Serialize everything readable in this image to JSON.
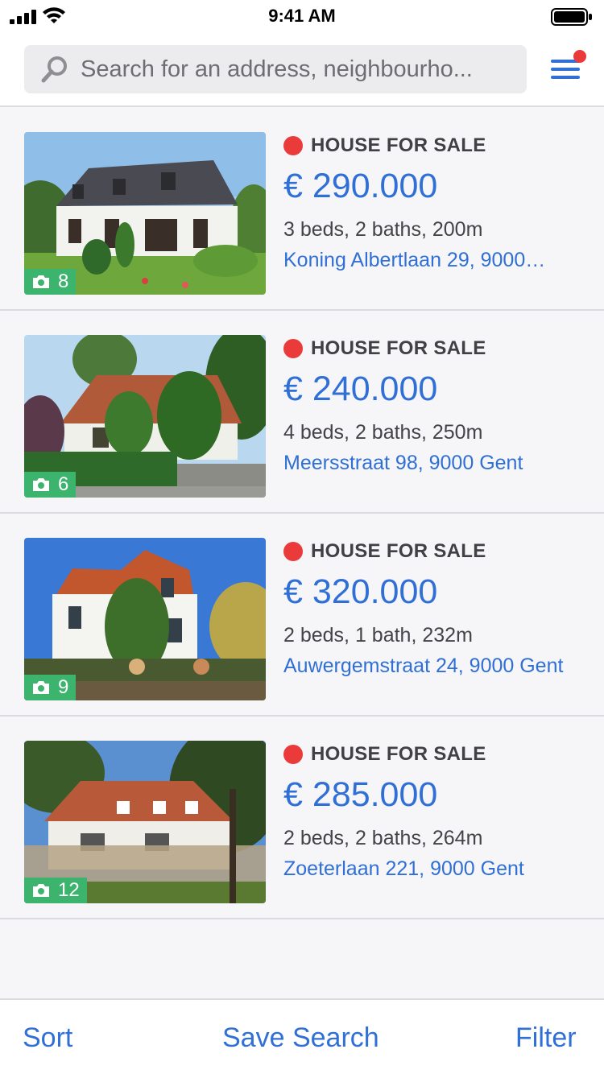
{
  "status_bar": {
    "time": "9:41 AM"
  },
  "search": {
    "placeholder": "Search for an address, neighbourho..."
  },
  "listings": [
    {
      "type": "HOUSE FOR SALE",
      "price": "€ 290.000",
      "specs": "3 beds, 2 baths, 200m",
      "address": "Koning Albertlaan 29, 9000…",
      "photo_count": "8"
    },
    {
      "type": "HOUSE FOR SALE",
      "price": "€ 240.000",
      "specs": "4 beds, 2 baths, 250m",
      "address": "Meersstraat 98, 9000 Gent",
      "photo_count": "6"
    },
    {
      "type": "HOUSE FOR SALE",
      "price": "€ 320.000",
      "specs": "2 beds, 1 bath, 232m",
      "address": "Auwergemstraat 24, 9000 Gent",
      "photo_count": "9"
    },
    {
      "type": "HOUSE FOR SALE",
      "price": "€ 285.000",
      "specs": "2 beds, 2 baths, 264m",
      "address": "Zoeterlaan 221, 9000 Gent",
      "photo_count": "12"
    }
  ],
  "toolbar": {
    "sort_label": "Sort",
    "save_search_label": "Save Search",
    "filter_label": "Filter"
  },
  "colors": {
    "accent": "#2f6fd6",
    "status_red": "#ea3a3a",
    "badge_green": "#3db46d"
  },
  "icons": [
    "signal-icon",
    "wifi-icon",
    "battery-icon",
    "search-icon",
    "menu-icon",
    "notification-dot-icon",
    "camera-icon"
  ]
}
